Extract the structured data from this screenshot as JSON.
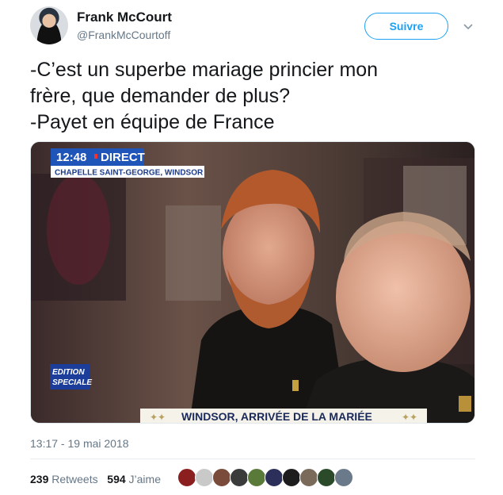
{
  "tweet": {
    "author_name": "Frank McCourt",
    "author_handle": "@FrankMcCourtoff",
    "follow_label": "Suivre",
    "text_lines": [
      "-C’est un superbe mariage princier mon",
      "frère, que demander de plus?",
      "-Payet en équipe de France"
    ],
    "timestamp": "13:17 - 19 mai 2018",
    "retweets_count": "239",
    "retweets_label": "Retweets",
    "likes_count": "594",
    "likes_label": "J’aime"
  },
  "media": {
    "overlay_time": "12:48",
    "overlay_live": "DIRECT",
    "overlay_location": "CHAPELLE SAINT-GEORGE, WINDSOR",
    "overlay_bottom": "WINDSOR, ARRIVÉE DE LA MARIÉE",
    "channel_badge_line1": "EDITION",
    "channel_badge_line2": "SPECIALE"
  },
  "likers": [
    {
      "color": "#8b1e1e"
    },
    {
      "color": "#c9c9c9"
    },
    {
      "color": "#7a4a3a"
    },
    {
      "color": "#3b3b3b"
    },
    {
      "color": "#5a7a3a"
    },
    {
      "color": "#2b2f5a"
    },
    {
      "color": "#1d1d1d"
    },
    {
      "color": "#7a6a5a"
    },
    {
      "color": "#2a4a2a"
    },
    {
      "color": "#6a7a8a"
    }
  ],
  "colors": {
    "accent": "#1da1f2",
    "secondary_text": "#657786"
  }
}
